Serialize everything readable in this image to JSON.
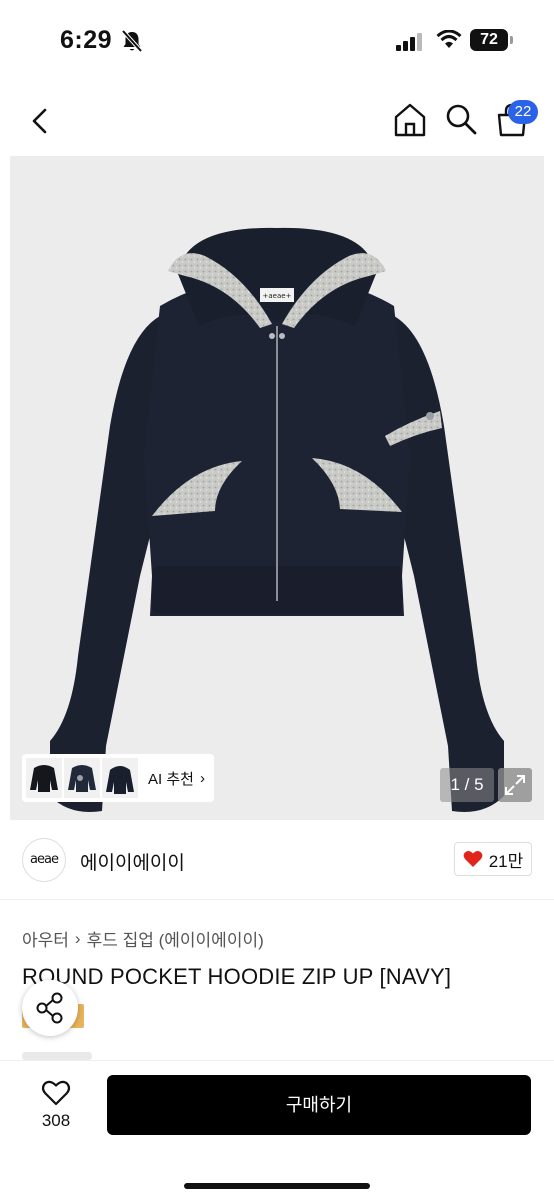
{
  "status_bar": {
    "time": "6:29",
    "battery": "72"
  },
  "nav": {
    "cart_badge": "22"
  },
  "gallery": {
    "ai_label": "AI 추천",
    "ai_chevron": "›",
    "counter": "1 / 5",
    "hoodie_logo_text": "+aeae+"
  },
  "brand": {
    "logo_text": "aeae",
    "name": "에이이에이이",
    "likes": "21만"
  },
  "product": {
    "category_parent": "아우터",
    "category_sep": "›",
    "category_child": "후드 집업 (에이이에이이)",
    "title": "ROUND POCKET HOODIE ZIP UP [NAVY]"
  },
  "bottom": {
    "wish_count": "308",
    "buy_label": "구매하기"
  },
  "colors": {
    "accent_blue": "#2a62e8",
    "heart_red": "#e1251b",
    "navy": "#1c2130",
    "heather_grey": "#c9cac6",
    "gold": "#e9b35b"
  },
  "icons": [
    "bell-slash-icon",
    "signal-icon",
    "wifi-icon",
    "back-icon",
    "home-icon",
    "search-icon",
    "cart-icon",
    "expand-icon",
    "heart-icon",
    "share-icon"
  ]
}
